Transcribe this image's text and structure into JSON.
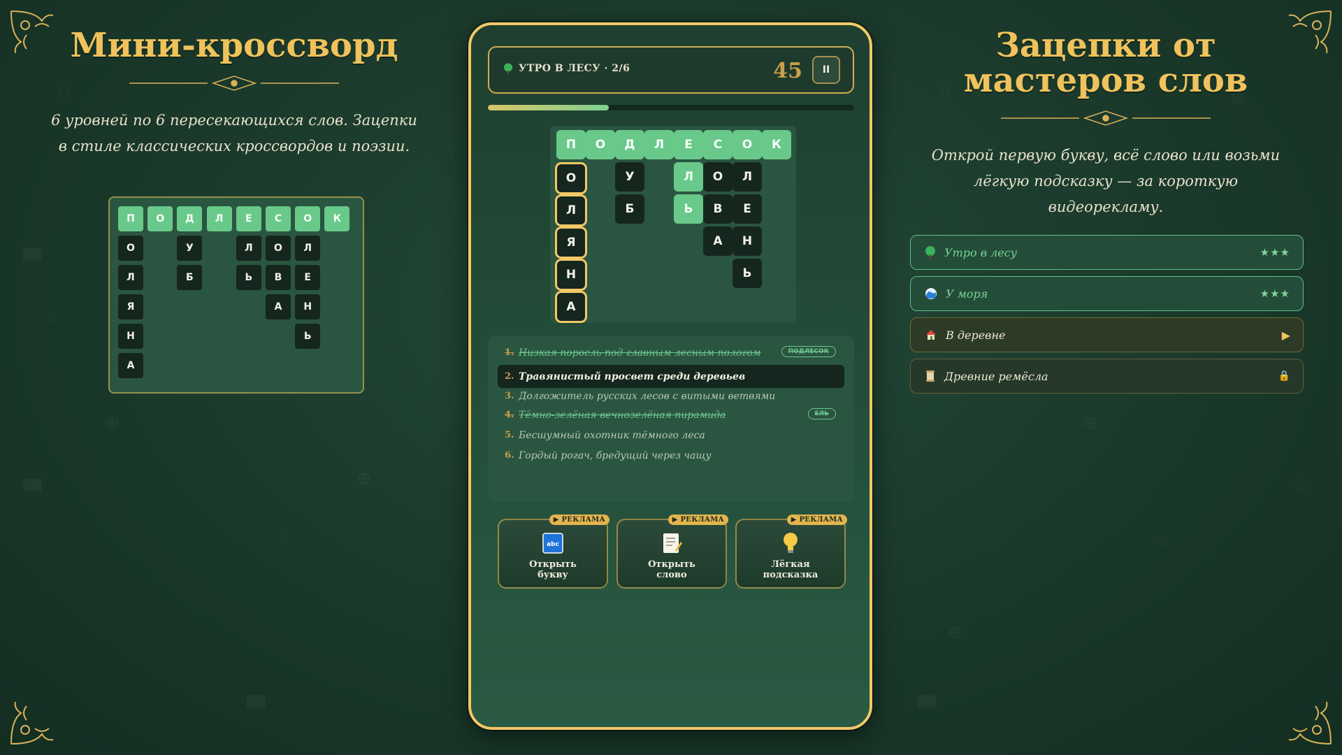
{
  "left_panel": {
    "title": "Мини-кроссворд",
    "subtitle": "6 уровней по 6 пересекающихся слов. Зацепки в стиле классических кроссвордов и поэзии."
  },
  "preview": {
    "cells": [
      {
        "t": "П",
        "r": 0,
        "c": 0,
        "s": "hl"
      },
      {
        "t": "О",
        "r": 0,
        "c": 1,
        "s": "hl"
      },
      {
        "t": "Д",
        "r": 0,
        "c": 2,
        "s": "hl"
      },
      {
        "t": "Л",
        "r": 0,
        "c": 3,
        "s": "hl"
      },
      {
        "t": "Е",
        "r": 0,
        "c": 4,
        "s": "hl"
      },
      {
        "t": "С",
        "r": 0,
        "c": 5,
        "s": "hl"
      },
      {
        "t": "О",
        "r": 0,
        "c": 6,
        "s": "hl"
      },
      {
        "t": "К",
        "r": 0,
        "c": 7,
        "s": "hl"
      },
      {
        "t": "О",
        "r": 1,
        "c": 0,
        "s": "dk"
      },
      {
        "t": "У",
        "r": 1,
        "c": 2,
        "s": "dk"
      },
      {
        "t": "Л",
        "r": 1,
        "c": 4,
        "s": "dk"
      },
      {
        "t": "О",
        "r": 1,
        "c": 5,
        "s": "dk"
      },
      {
        "t": "Л",
        "r": 1,
        "c": 6,
        "s": "dk"
      },
      {
        "t": "Л",
        "r": 2,
        "c": 0,
        "s": "dk"
      },
      {
        "t": "Б",
        "r": 2,
        "c": 2,
        "s": "dk"
      },
      {
        "t": "Ь",
        "r": 2,
        "c": 4,
        "s": "dk"
      },
      {
        "t": "В",
        "r": 2,
        "c": 5,
        "s": "dk"
      },
      {
        "t": "Е",
        "r": 2,
        "c": 6,
        "s": "dk"
      },
      {
        "t": "Я",
        "r": 3,
        "c": 0,
        "s": "dk"
      },
      {
        "t": "А",
        "r": 3,
        "c": 5,
        "s": "dk"
      },
      {
        "t": "Н",
        "r": 3,
        "c": 6,
        "s": "dk"
      },
      {
        "t": "Н",
        "r": 4,
        "c": 0,
        "s": "dk"
      },
      {
        "t": "Ь",
        "r": 4,
        "c": 6,
        "s": "dk"
      },
      {
        "t": "А",
        "r": 5,
        "c": 0,
        "s": "dk"
      }
    ]
  },
  "game": {
    "level_label": "УТРО В ЛЕСУ · 2/6",
    "timer": "45",
    "pause_label": "II",
    "progress": 0.33,
    "board": [
      {
        "t": "П",
        "r": 0,
        "c": 0,
        "s": "hl"
      },
      {
        "t": "О",
        "r": 0,
        "c": 1,
        "s": "hl"
      },
      {
        "t": "Д",
        "r": 0,
        "c": 2,
        "s": "hl"
      },
      {
        "t": "Л",
        "r": 0,
        "c": 3,
        "s": "hl"
      },
      {
        "t": "Е",
        "r": 0,
        "c": 4,
        "s": "hl"
      },
      {
        "t": "С",
        "r": 0,
        "c": 5,
        "s": "hl"
      },
      {
        "t": "О",
        "r": 0,
        "c": 6,
        "s": "hl"
      },
      {
        "t": "К",
        "r": 0,
        "c": 7,
        "s": "hl"
      },
      {
        "t": "О",
        "r": 1,
        "c": 0,
        "s": "sel"
      },
      {
        "t": "У",
        "r": 1,
        "c": 2,
        "s": "dk"
      },
      {
        "t": "Л",
        "r": 1,
        "c": 4,
        "s": "hl"
      },
      {
        "t": "О",
        "r": 1,
        "c": 5,
        "s": "dk"
      },
      {
        "t": "Л",
        "r": 1,
        "c": 6,
        "s": "dk"
      },
      {
        "t": "Л",
        "r": 2,
        "c": 0,
        "s": "sel"
      },
      {
        "t": "Б",
        "r": 2,
        "c": 2,
        "s": "dk"
      },
      {
        "t": "Ь",
        "r": 2,
        "c": 4,
        "s": "hl"
      },
      {
        "t": "В",
        "r": 2,
        "c": 5,
        "s": "dk"
      },
      {
        "t": "Е",
        "r": 2,
        "c": 6,
        "s": "dk"
      },
      {
        "t": "Я",
        "r": 3,
        "c": 0,
        "s": "sel"
      },
      {
        "t": "А",
        "r": 3,
        "c": 5,
        "s": "dk"
      },
      {
        "t": "Н",
        "r": 3,
        "c": 6,
        "s": "dk"
      },
      {
        "t": "Н",
        "r": 4,
        "c": 0,
        "s": "sel"
      },
      {
        "t": "Ь",
        "r": 4,
        "c": 6,
        "s": "dk"
      },
      {
        "t": "А",
        "r": 5,
        "c": 0,
        "s": "sel"
      }
    ],
    "clues": [
      {
        "num": "1.",
        "text": "Низкая поросль под главным лесным пологом",
        "state": "done",
        "answer": "ПОДЛЕСОК"
      },
      {
        "num": "2.",
        "text": "Травянистый просвет среди деревьев",
        "state": "active",
        "answer": ""
      },
      {
        "num": "3.",
        "text": "Долгожитель русских лесов с витыми ветвями",
        "state": "todo",
        "answer": ""
      },
      {
        "num": "4.",
        "text": "Тёмно-зелёная вечнозелёная пирамида",
        "state": "done",
        "answer": "ЕЛЬ"
      },
      {
        "num": "5.",
        "text": "Бесшумный охотник тёмного леса",
        "state": "todo",
        "answer": ""
      },
      {
        "num": "6.",
        "text": "Гордый рогач, бредущий через чащу",
        "state": "todo",
        "answer": ""
      }
    ],
    "hints": [
      {
        "ad": "▶ РЕКЛАМА",
        "label": "Открыть\nбукву",
        "icon": "abc-icon"
      },
      {
        "ad": "▶ РЕКЛАМА",
        "label": "Открыть\nслово",
        "icon": "memo-icon"
      },
      {
        "ad": "▶ РЕКЛАМА",
        "label": "Лёгкая\nподсказка",
        "icon": "lightbulb-icon"
      }
    ]
  },
  "right_panel": {
    "title": "Зацепки от мастеров слов",
    "subtitle": "Открой первую букву, всё слово или возьми лёгкую подсказку — за короткую видеорекламу.",
    "levels": [
      {
        "name": "Утро в лесу",
        "state": "open",
        "icon": "tree-icon",
        "right": "★★★"
      },
      {
        "name": "У моря",
        "state": "open",
        "icon": "wave-icon",
        "right": "★★★"
      },
      {
        "name": "В деревне",
        "state": "next",
        "icon": "house-icon",
        "right": "▶"
      },
      {
        "name": "Древние ремёсла",
        "state": "locked",
        "icon": "scroll-icon",
        "right": "🔒"
      }
    ]
  },
  "colors": {
    "gold": "#f0c25c",
    "mint": "#69c98a",
    "dark_cell": "#15261e",
    "panel": "#2a5540"
  }
}
